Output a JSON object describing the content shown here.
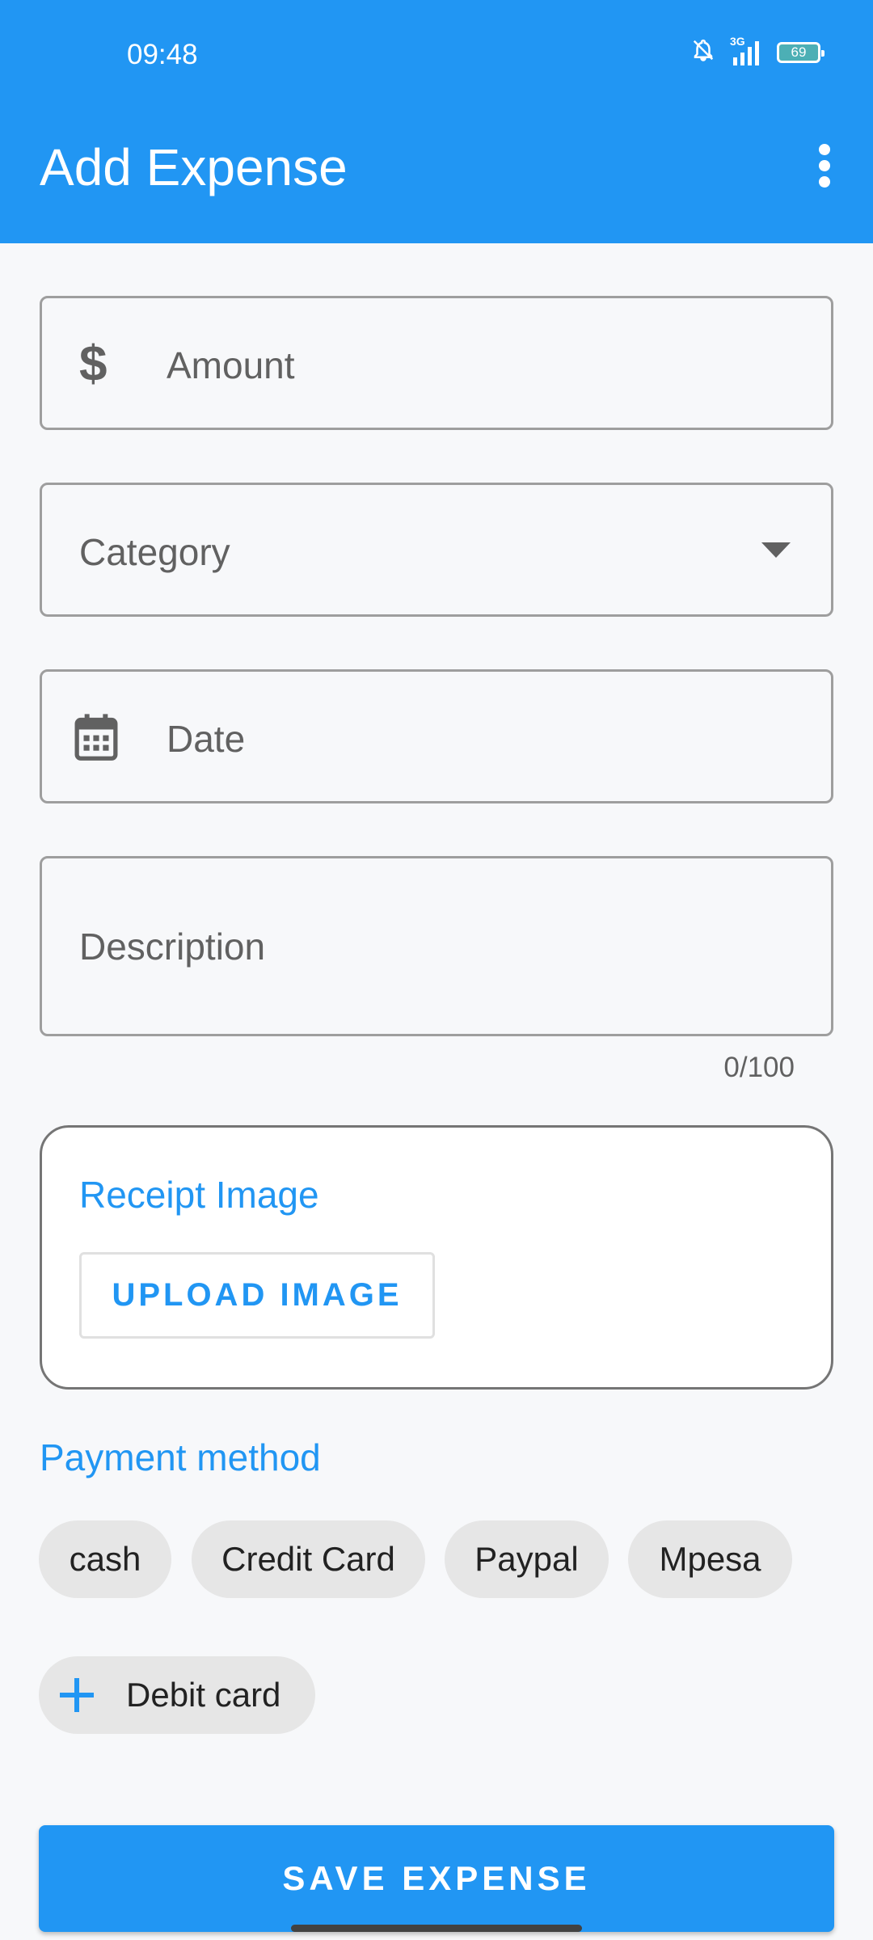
{
  "status_bar": {
    "time": "09:48",
    "network": "3G",
    "battery": "69"
  },
  "appbar": {
    "title": "Add Expense",
    "more_icon": "more-vert-icon"
  },
  "form": {
    "amount": {
      "label": "Amount",
      "icon": "dollar-icon"
    },
    "category": {
      "label": "Category",
      "icon": "dropdown-arrow-icon"
    },
    "date": {
      "label": "Date",
      "icon": "calendar-icon"
    },
    "description": {
      "label": "Description",
      "counter": "0/100"
    }
  },
  "receipt": {
    "title": "Receipt Image",
    "upload_label": "UPLOAD IMAGE"
  },
  "payment": {
    "title": "Payment method",
    "chips": [
      "cash",
      "Credit Card",
      "Paypal",
      "Mpesa"
    ],
    "add_chip": {
      "label": "Debit card",
      "icon": "plus-icon"
    }
  },
  "save_label": "SAVE EXPENSE",
  "colors": {
    "primary": "#2196F3",
    "background": "#F7F8FA",
    "chip": "#E6E6E6"
  }
}
